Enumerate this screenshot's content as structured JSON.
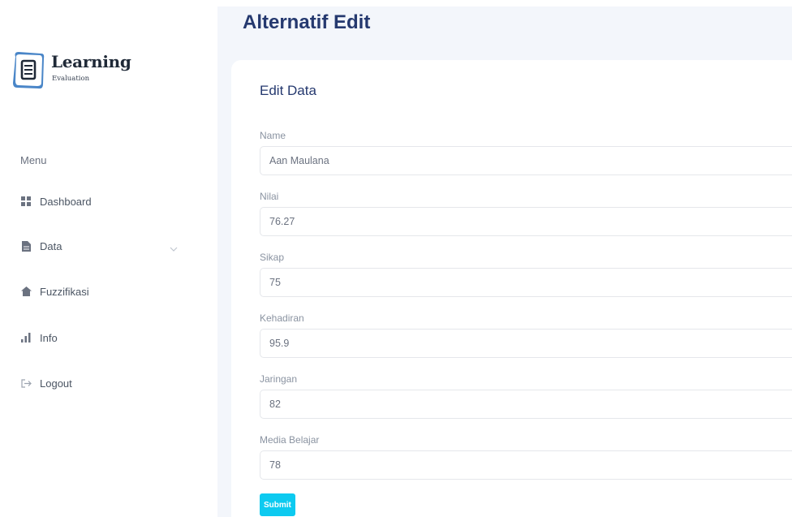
{
  "brand": {
    "title": "Learning",
    "subtitle": "Evaluation"
  },
  "sidebar": {
    "menu_title": "Menu",
    "items": [
      {
        "label": "Dashboard",
        "icon": "grid-icon"
      },
      {
        "label": "Data",
        "icon": "file-icon",
        "has_dropdown": true
      },
      {
        "label": "Fuzzifikasi",
        "icon": "house-icon"
      },
      {
        "label": "Info",
        "icon": "bar-chart-icon"
      },
      {
        "label": "Logout",
        "icon": "logout-icon"
      }
    ]
  },
  "page": {
    "title": "Alternatif Edit"
  },
  "form": {
    "title": "Edit Data",
    "fields": [
      {
        "label": "Name",
        "value": "Aan Maulana"
      },
      {
        "label": "Nilai",
        "value": "76.27"
      },
      {
        "label": "Sikap",
        "value": "75"
      },
      {
        "label": "Kehadiran",
        "value": "95.9"
      },
      {
        "label": "Jaringan",
        "value": "82"
      },
      {
        "label": "Media Belajar",
        "value": "78"
      }
    ],
    "submit_label": "Submit"
  },
  "colors": {
    "accent": "#25396f",
    "submit": "#0dcaf0",
    "background": "#f3f6fb"
  }
}
